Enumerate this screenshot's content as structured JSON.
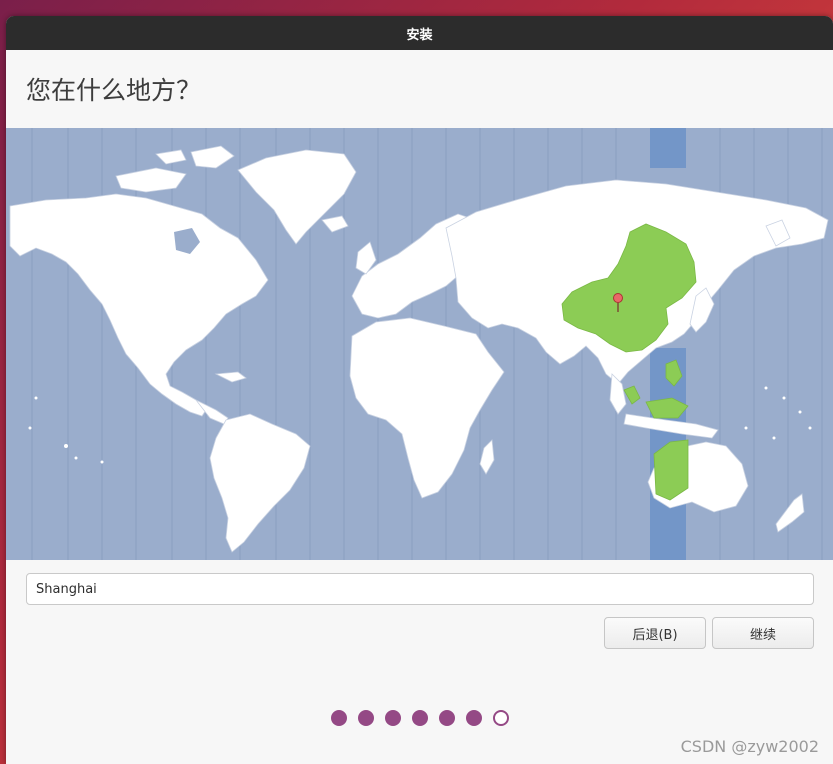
{
  "window": {
    "title": "安装"
  },
  "page": {
    "heading": "您在什么地方？"
  },
  "location": {
    "value": "Shanghai"
  },
  "buttons": {
    "back": "后退(B)",
    "continue": "继续"
  },
  "progress": {
    "total_steps": 7,
    "current_step": 6
  },
  "watermark": "CSDN @zyw2002",
  "colors": {
    "ocean": "#9aadcc",
    "land": "#ffffff",
    "selected_zone": "#8ccc55",
    "timezone_band": "#7396c8",
    "accent": "#944985"
  },
  "map": {
    "selected_marker": "pin-icon"
  }
}
